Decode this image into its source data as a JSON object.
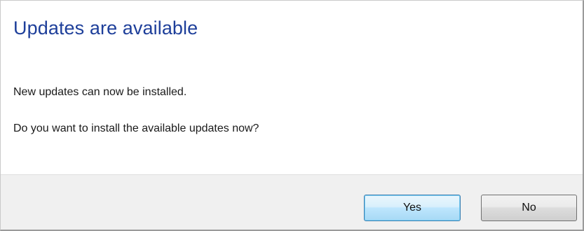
{
  "dialog": {
    "title": "Updates are available",
    "message_line1": "New updates can now be installed.",
    "message_line2": "Do you want to install the available updates now?"
  },
  "buttons": {
    "yes_label": "Yes",
    "no_label": "No"
  },
  "colors": {
    "title": "#1e3f9a",
    "footer_background": "#f0f0f0",
    "default_button_border": "#3c7fb1"
  }
}
